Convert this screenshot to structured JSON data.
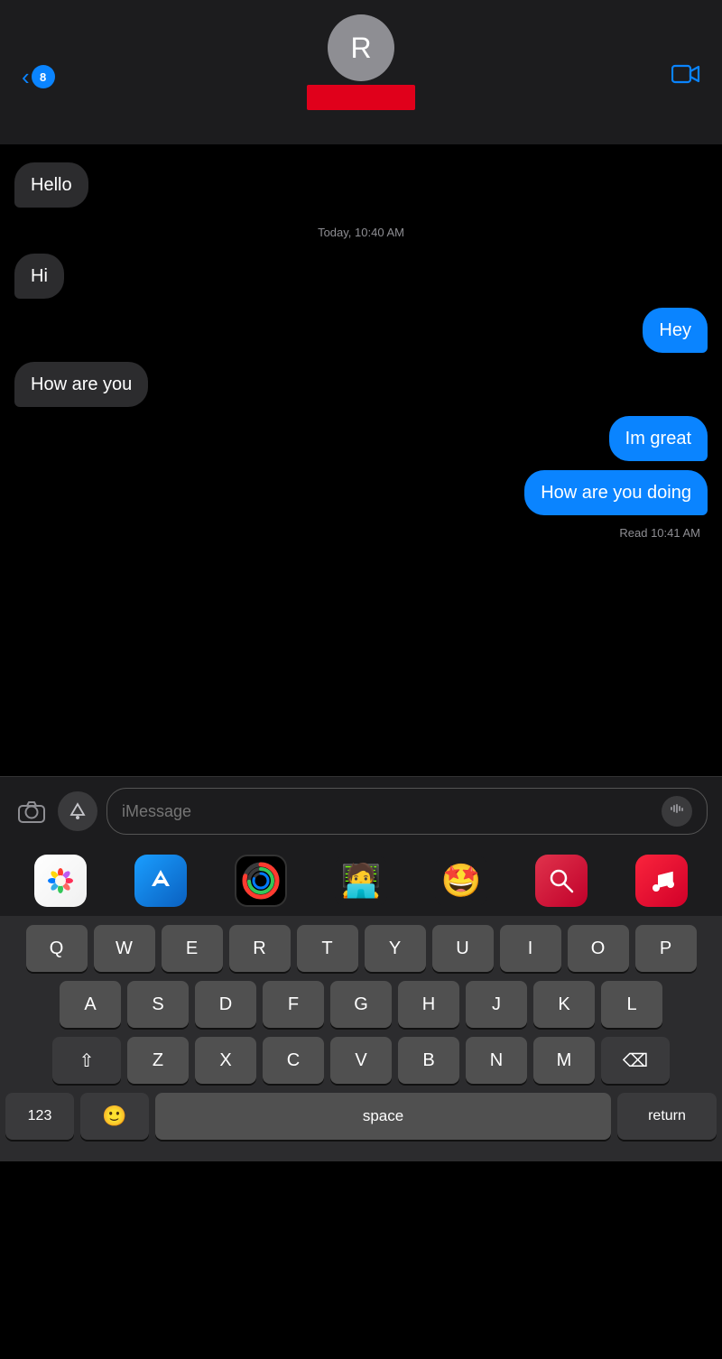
{
  "header": {
    "back_count": "8",
    "avatar_letter": "R",
    "video_icon": "video-camera-icon",
    "back_label": "8"
  },
  "messages": [
    {
      "id": 1,
      "type": "received",
      "text": "Hello"
    },
    {
      "id": 2,
      "type": "timestamp",
      "text": "Today, 10:40 AM"
    },
    {
      "id": 3,
      "type": "received",
      "text": "Hi"
    },
    {
      "id": 4,
      "type": "sent",
      "text": "Hey"
    },
    {
      "id": 5,
      "type": "received",
      "text": "How are you"
    },
    {
      "id": 6,
      "type": "sent",
      "text": "Im great"
    },
    {
      "id": 7,
      "type": "sent",
      "text": "How are you doing"
    },
    {
      "id": 8,
      "type": "read",
      "text": "Read 10:41 AM"
    }
  ],
  "input": {
    "placeholder": "iMessage"
  },
  "apps": [
    {
      "id": "photos",
      "label": "Photos"
    },
    {
      "id": "appstore",
      "label": "App Store"
    },
    {
      "id": "fitness",
      "label": "Fitness"
    },
    {
      "id": "memoji",
      "label": "Memoji"
    },
    {
      "id": "stickers",
      "label": "Stickers"
    },
    {
      "id": "search",
      "label": "App Search"
    },
    {
      "id": "music",
      "label": "Music"
    }
  ],
  "keyboard": {
    "rows": [
      [
        "Q",
        "W",
        "E",
        "R",
        "T",
        "Y",
        "U",
        "I",
        "O",
        "P"
      ],
      [
        "A",
        "S",
        "D",
        "F",
        "G",
        "H",
        "J",
        "K",
        "L"
      ],
      [
        "Z",
        "X",
        "C",
        "V",
        "B",
        "N",
        "M"
      ]
    ],
    "space_label": "space",
    "return_label": "return",
    "numbers_label": "123"
  }
}
